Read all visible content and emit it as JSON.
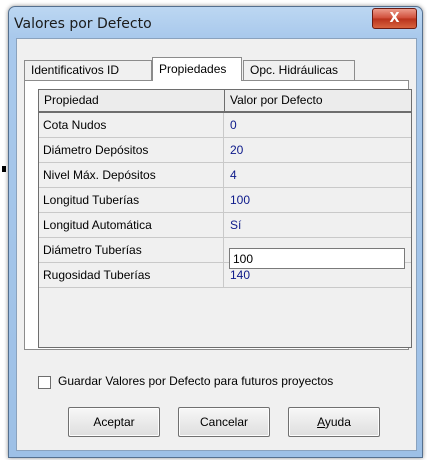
{
  "window": {
    "title": "Valores por Defecto",
    "close_glyph": "X"
  },
  "tabs": [
    {
      "label": "Identificativos ID",
      "active": false
    },
    {
      "label": "Propiedades",
      "active": true
    },
    {
      "label": "Opc. Hidráulicas",
      "active": false
    }
  ],
  "grid": {
    "headers": [
      "Propiedad",
      "Valor por Defecto"
    ],
    "rows": [
      {
        "prop": "Cota Nudos",
        "value": "0"
      },
      {
        "prop": "Diámetro Depósitos",
        "value": "20"
      },
      {
        "prop": "Nivel Máx. Depósitos",
        "value": "4"
      },
      {
        "prop": "Longitud Tuberías",
        "value": "100"
      },
      {
        "prop": "Longitud Automática",
        "value": "Sí"
      },
      {
        "prop": "Diámetro Tuberías",
        "value": "100"
      },
      {
        "prop": "Rugosidad Tuberías",
        "value": "140"
      }
    ],
    "editing_row": 5
  },
  "save_defaults": {
    "label": "Guardar Valores por Defecto para futuros proyectos",
    "checked": false
  },
  "buttons": {
    "accept": "Aceptar",
    "cancel": "Cancelar",
    "help_accel": "A",
    "help_rest": "yuda"
  },
  "colors": {
    "value_text": "#0d1a8a",
    "title_bar": "#a9c9ec",
    "close_button": "#cf4b36"
  }
}
